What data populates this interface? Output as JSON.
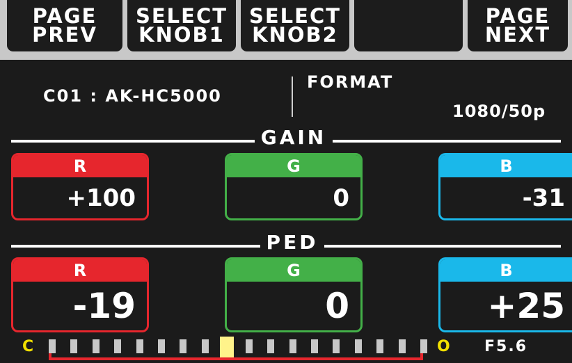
{
  "softkeys": [
    {
      "line1": "PAGE",
      "line2": "PREV"
    },
    {
      "line1": "SELECT",
      "line2": "KNOB1"
    },
    {
      "line1": "SELECT",
      "line2": "KNOB2"
    },
    {
      "line1": "",
      "line2": ""
    },
    {
      "line1": "PAGE",
      "line2": "NEXT"
    }
  ],
  "info": {
    "camera": "C01 : AK-HC5000",
    "format_label": "FORMAT",
    "format_value": "1080/50p"
  },
  "gain": {
    "title": "GAIN",
    "r_label": "R",
    "r_value": "+100",
    "g_label": "G",
    "g_value": "0",
    "b_label": "B",
    "b_value": "-31"
  },
  "ped": {
    "title": "PED",
    "r_label": "R",
    "r_value": "-19",
    "g_label": "G",
    "g_value": "0",
    "b_label": "B",
    "b_value": "+25"
  },
  "iris": {
    "c_label": "C",
    "o_label": "O",
    "f_number": "F5.6",
    "tick_count": 18,
    "position_fraction": 0.5
  },
  "colors": {
    "red": "#e6262d",
    "green": "#43b048",
    "blue": "#1ab8ea",
    "yellow": "#f2e000"
  }
}
